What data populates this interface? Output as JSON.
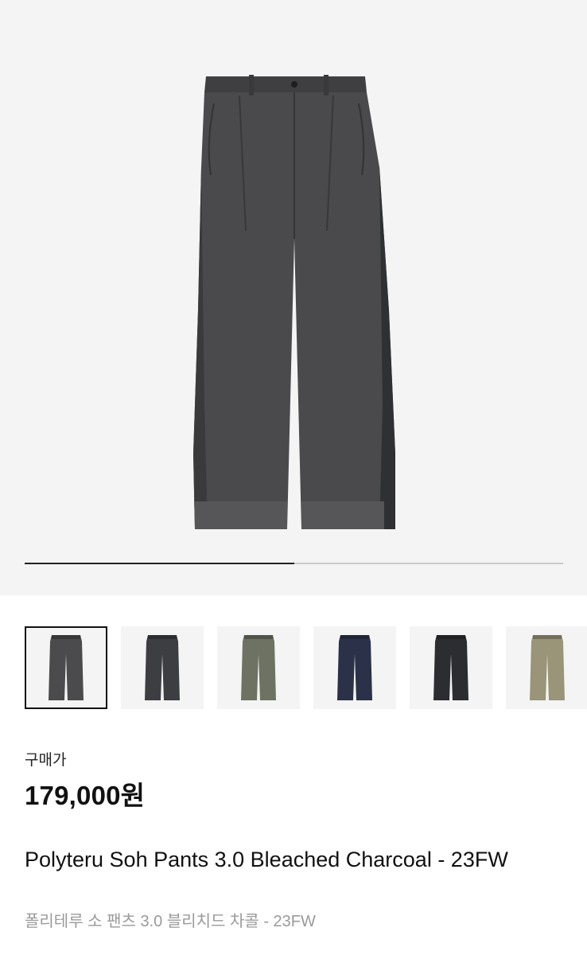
{
  "gallery": {
    "main_image": "pants-bleached-charcoal-image",
    "progress_fraction": 0.5,
    "thumbnails": [
      {
        "name": "thumb-bleached-charcoal",
        "color": "#4b4b4d",
        "selected": true
      },
      {
        "name": "thumb-charcoal-belted",
        "color": "#3c3e42",
        "selected": false
      },
      {
        "name": "thumb-olive-belted",
        "color": "#6d7262",
        "selected": false
      },
      {
        "name": "thumb-navy",
        "color": "#2a3148",
        "selected": false
      },
      {
        "name": "thumb-black",
        "color": "#2c2d31",
        "selected": false
      },
      {
        "name": "thumb-khaki",
        "color": "#9a9478",
        "selected": false
      }
    ]
  },
  "product": {
    "price_label": "구매가",
    "price": "179,000원",
    "title_en": "Polyteru Soh Pants 3.0 Bleached Charcoal - 23FW",
    "title_ko": "폴리테루 소 팬츠 3.0 블리치드 차콜 - 23FW"
  },
  "colors": {
    "hero_bg": "#f4f4f4",
    "progress_track": "#c9c9c9",
    "progress_fill": "#222222",
    "subtitle": "#9a9a9a"
  }
}
